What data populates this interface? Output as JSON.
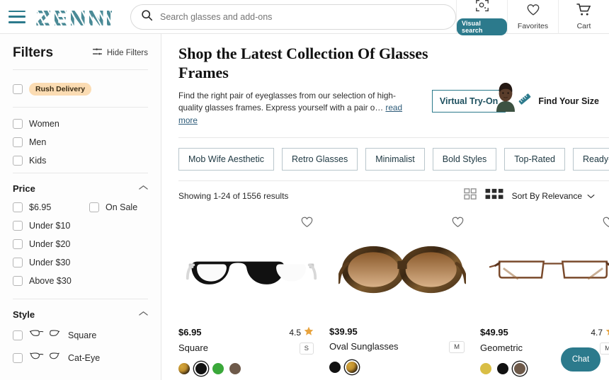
{
  "header": {
    "menu_icon": "hamburger-icon",
    "logo_text": "ZENNI",
    "search": {
      "icon": "search-icon",
      "placeholder": "Search glasses and add-ons",
      "value": ""
    },
    "actions": [
      {
        "icon": "visual-search-icon",
        "label": "Visual search",
        "is_pill": true
      },
      {
        "icon": "heart-icon",
        "label": "Favorites",
        "is_pill": false
      },
      {
        "icon": "cart-icon",
        "label": "Cart",
        "is_pill": false
      }
    ]
  },
  "sidebar": {
    "title": "Filters",
    "hide_filters_label": "Hide Filters",
    "hide_filters_icon": "sliders-icon",
    "rush_delivery": {
      "label": "Rush Delivery",
      "checked": false
    },
    "audience": [
      {
        "label": "Women",
        "checked": false
      },
      {
        "label": "Men",
        "checked": false
      },
      {
        "label": "Kids",
        "checked": false
      }
    ],
    "price": {
      "title": "Price",
      "chevron": "chevron-up-icon",
      "options_left": [
        {
          "label": "$6.95",
          "checked": false
        },
        {
          "label": "Under $10",
          "checked": false
        },
        {
          "label": "Under $20",
          "checked": false
        },
        {
          "label": "Under $30",
          "checked": false
        },
        {
          "label": "Above $30",
          "checked": false
        }
      ],
      "options_right": [
        {
          "label": "On Sale",
          "checked": false
        }
      ]
    },
    "style": {
      "title": "Style",
      "chevron": "chevron-up-icon",
      "options": [
        {
          "label": "Square",
          "icon": "glasses-square-icon",
          "checked": false
        },
        {
          "label": "Cat-Eye",
          "icon": "glasses-cateye-icon",
          "checked": false
        }
      ]
    }
  },
  "main": {
    "page_title": "Shop the Latest Collection Of Glasses Frames",
    "intro_text": "Find the right pair of eyeglasses from our selection of high-quality glasses frames. Express yourself with a pair o… ",
    "read_more_label": "read more",
    "virtual_tryon_label": "Virtual Try-On",
    "find_your_size_label": "Find Your Size",
    "find_your_size_icon": "ruler-icon",
    "chips": [
      "Mob Wife Aesthetic",
      "Retro Glasses",
      "Minimalist",
      "Bold Styles",
      "Top-Rated",
      "Ready-to-W"
    ],
    "results_count": "Showing 1-24 of 1556 results",
    "view_toggles": [
      {
        "icon": "grid-2-col-icon",
        "active": false
      },
      {
        "icon": "grid-3-col-icon",
        "active": true
      }
    ],
    "sort_label": "Sort By Relevance",
    "sort_chevron": "chevron-down-icon",
    "products": [
      {
        "image": "black-square-eyeglasses",
        "favorite_icon": "heart-icon",
        "price": "$6.95",
        "rating": "4.5",
        "rating_icon": "star-icon",
        "name": "Square",
        "size": "S",
        "swatches": [
          {
            "color": "tortoise",
            "hex": "#C08F2E",
            "selected": false
          },
          {
            "color": "black",
            "hex": "#111111",
            "selected": true
          },
          {
            "color": "green",
            "hex": "#3AA83A",
            "selected": false
          },
          {
            "color": "brown",
            "hex": "#6E5A4A",
            "selected": false
          }
        ]
      },
      {
        "image": "tortoise-oval-sunglasses",
        "favorite_icon": "heart-icon",
        "price": "$39.95",
        "rating": "",
        "rating_icon": "",
        "name": "Oval Sunglasses",
        "size": "M",
        "swatches": [
          {
            "color": "black",
            "hex": "#111111",
            "selected": false
          },
          {
            "color": "tortoise",
            "hex": "#C08F2E",
            "selected": true
          }
        ]
      },
      {
        "image": "brown-geometric-metal-eyeglasses",
        "favorite_icon": "heart-icon",
        "price": "$49.95",
        "rating": "4.7",
        "rating_icon": "star-icon",
        "name": "Geometric",
        "size": "M",
        "swatches": [
          {
            "color": "gold",
            "hex": "#D9BE45",
            "selected": false
          },
          {
            "color": "black",
            "hex": "#111111",
            "selected": false
          },
          {
            "color": "brown",
            "hex": "#6E5A4A",
            "selected": true
          }
        ]
      }
    ],
    "chat_label": "Chat"
  },
  "colors": {
    "brand_teal": "#2C7A8C",
    "rush_pill_bg": "#FBDCB3",
    "star_amber": "#E8A33D",
    "chip_border": "#B9C6CC"
  }
}
